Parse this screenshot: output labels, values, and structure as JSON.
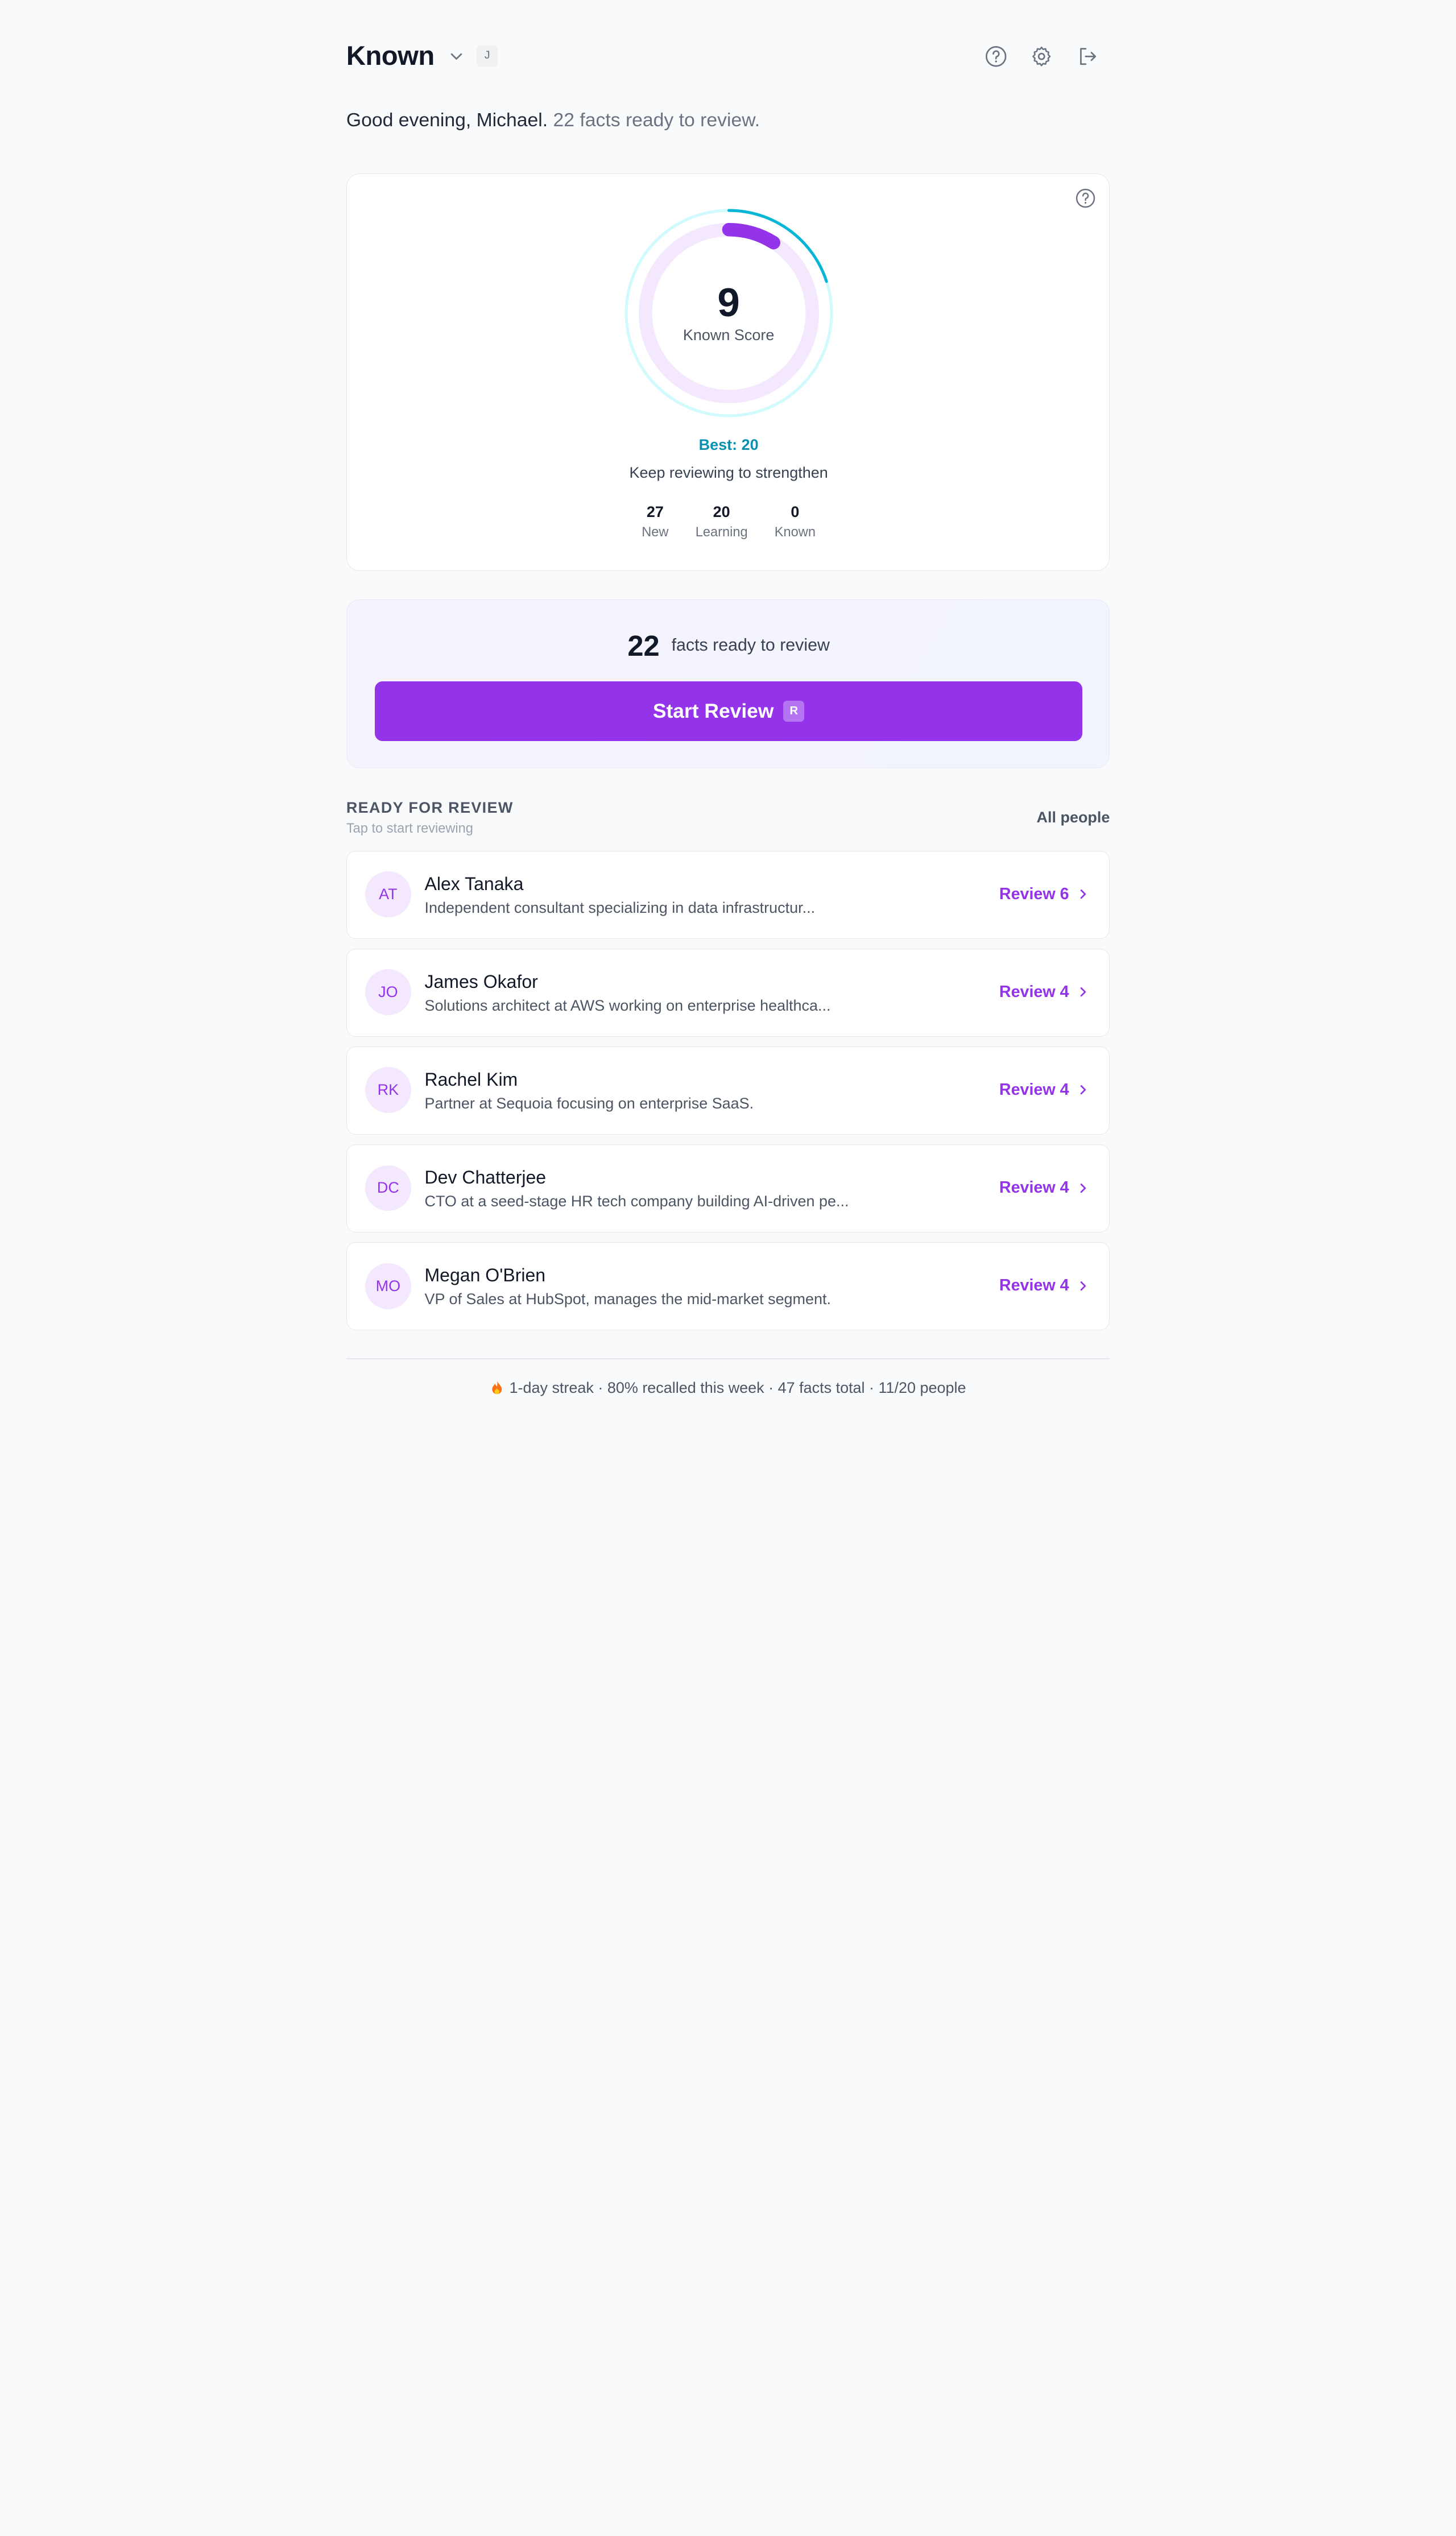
{
  "header": {
    "brand": "Known",
    "shortcut_key": "J",
    "icons": [
      "help-circle-icon",
      "gear-icon",
      "logout-icon"
    ]
  },
  "greeting": {
    "text": "Good evening, Michael.",
    "status": "22 facts ready to review."
  },
  "score_card": {
    "score": "9",
    "score_label": "Known Score",
    "best": "Best: 20",
    "message": "Keep reviewing to strengthen",
    "progress_fraction": 0.09,
    "best_fraction": 0.2,
    "stats": [
      {
        "value": "27",
        "label": "New"
      },
      {
        "value": "20",
        "label": "Learning"
      },
      {
        "value": "0",
        "label": "Known"
      }
    ]
  },
  "review_panel": {
    "count": "22",
    "text": "facts ready to review",
    "button_label": "Start Review",
    "button_shortcut": "R"
  },
  "ready_section": {
    "title": "READY FOR REVIEW",
    "subtitle": "Tap to start reviewing",
    "all_people": "All people"
  },
  "people": [
    {
      "initials": "AT",
      "name": "Alex Tanaka",
      "description": "Independent consultant specializing in data infrastructur...",
      "review": "Review 6"
    },
    {
      "initials": "JO",
      "name": "James Okafor",
      "description": "Solutions architect at AWS working on enterprise healthca...",
      "review": "Review 4"
    },
    {
      "initials": "RK",
      "name": "Rachel Kim",
      "description": "Partner at Sequoia focusing on enterprise SaaS.",
      "review": "Review 4"
    },
    {
      "initials": "DC",
      "name": "Dev Chatterjee",
      "description": "CTO at a seed-stage HR tech company building AI-driven pe...",
      "review": "Review 4"
    },
    {
      "initials": "MO",
      "name": "Megan O'Brien",
      "description": "VP of Sales at HubSpot, manages the mid-market segment.",
      "review": "Review 4"
    }
  ],
  "footer": {
    "text": "1-day streak · 80% recalled this week · 47 facts total · 11/20 people"
  },
  "colors": {
    "accent": "#9333ea",
    "best": "#0891b2",
    "ring_track": "#f3e8fd",
    "outer_track": "#cffafe"
  }
}
